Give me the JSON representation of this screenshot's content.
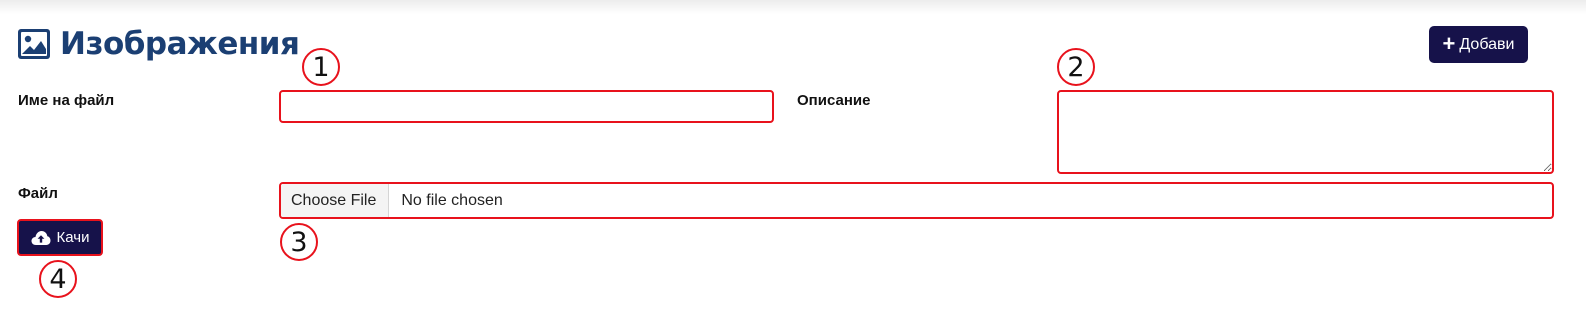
{
  "page": {
    "title": "Изображения",
    "title_icon": "image-icon",
    "title_color": "#1b3f73"
  },
  "toolbar": {
    "add_label": "Добави",
    "add_icon": "plus-icon",
    "button_color": "#16124a"
  },
  "form": {
    "filename_label": "Име на файл",
    "filename_value": "",
    "description_label": "Описание",
    "description_value": "",
    "file_label": "Файл",
    "choose_file_label": "Choose File",
    "file_status": "No file chosen",
    "upload_label": "Качи",
    "upload_icon": "cloud-upload-icon"
  },
  "annotations": {
    "highlight_color": "#e8121c",
    "markers": [
      "1",
      "2",
      "3",
      "4"
    ]
  }
}
